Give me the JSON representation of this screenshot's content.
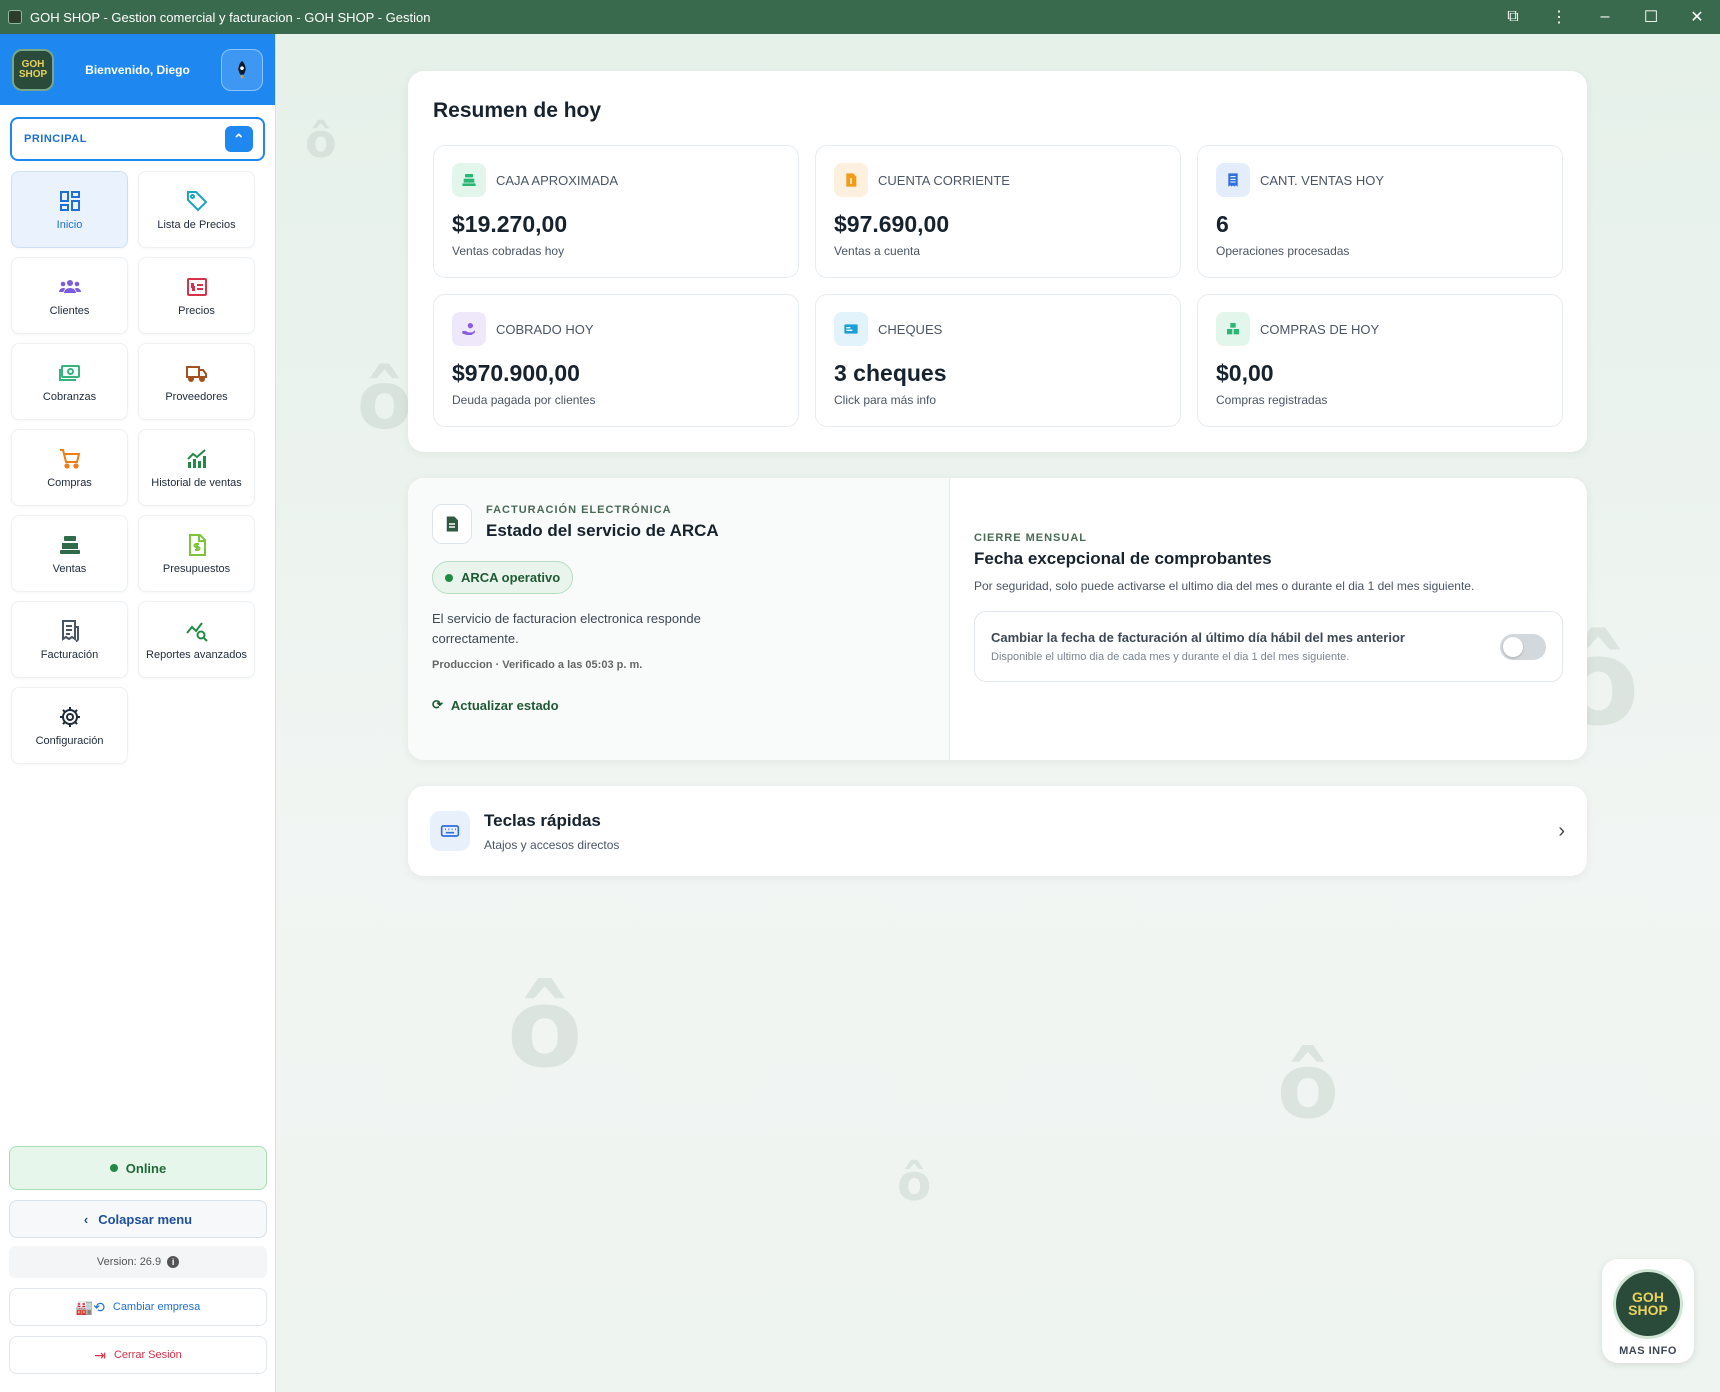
{
  "window": {
    "title": "GOH SHOP - Gestion comercial y facturacion - GOH SHOP - Gestion"
  },
  "sidebar": {
    "logo_text": "GOH SHOP",
    "welcome": "Bienvenido, Diego",
    "section_label": "PRINCIPAL",
    "items": [
      {
        "label": "Inicio",
        "icon": "dashboard-icon",
        "color": "#1e6fd6"
      },
      {
        "label": "Lista de Precios",
        "icon": "tag-icon",
        "color": "#1aa3c4"
      },
      {
        "label": "Clientes",
        "icon": "users-icon",
        "color": "#7b5ce0"
      },
      {
        "label": "Precios",
        "icon": "price-tag-icon",
        "color": "#d6324a"
      },
      {
        "label": "Cobranzas",
        "icon": "money-icon",
        "color": "#36b37e"
      },
      {
        "label": "Proveedores",
        "icon": "truck-icon",
        "color": "#a4511f"
      },
      {
        "label": "Compras",
        "icon": "cart-icon",
        "color": "#f07c16"
      },
      {
        "label": "Historial de ventas",
        "icon": "chart-line-icon",
        "color": "#238a45"
      },
      {
        "label": "Ventas",
        "icon": "cash-register-icon",
        "color": "#2f6a4a"
      },
      {
        "label": "Presupuestos",
        "icon": "file-dollar-icon",
        "color": "#7cc43a"
      },
      {
        "label": "Facturación",
        "icon": "receipt-icon",
        "color": "#4a5565"
      },
      {
        "label": "Reportes avanzados",
        "icon": "search-chart-icon",
        "color": "#238a45"
      },
      {
        "label": "Configuración",
        "icon": "gear-icon",
        "color": "#1e2a3a"
      }
    ],
    "status": "Online",
    "collapse_label": "Colapsar menu",
    "version": "Version: 26.9",
    "switch_company": "Cambiar empresa",
    "logout": "Cerrar Sesión"
  },
  "summary": {
    "title": "Resumen de hoy",
    "stats": [
      {
        "label": "CAJA APROXIMADA",
        "value": "$19.270,00",
        "sub": "Ventas cobradas hoy",
        "icon": "cash-register-icon",
        "color": "#2bb673",
        "bg": "#e3f6ec"
      },
      {
        "label": "CUENTA CORRIENTE",
        "value": "$97.690,00",
        "sub": "Ventas a cuenta",
        "icon": "file-dollar-icon",
        "color": "#f29b16",
        "bg": "#fdf0de"
      },
      {
        "label": "CANT. VENTAS HOY",
        "value": "6",
        "sub": "Operaciones procesadas",
        "icon": "receipt-icon",
        "color": "#2f6fe0",
        "bg": "#e4edfb"
      },
      {
        "label": "COBRADO HOY",
        "value": "$970.900,00",
        "sub": "Deuda pagada por clientes",
        "icon": "hand-money-icon",
        "color": "#8a5ce0",
        "bg": "#efe8fb"
      },
      {
        "label": "CHEQUES",
        "value": "3 cheques",
        "sub": "Click para más info",
        "icon": "check-icon",
        "color": "#1ea0d6",
        "bg": "#e2f3fb"
      },
      {
        "label": "COMPRAS DE HOY",
        "value": "$0,00",
        "sub": "Compras registradas",
        "icon": "boxes-icon",
        "color": "#2bb673",
        "bg": "#e3f6ec"
      }
    ]
  },
  "arca": {
    "eyebrow": "FACTURACIÓN ELECTRÓNICA",
    "title": "Estado del servicio de ARCA",
    "status": "ARCA operativo",
    "description": "El servicio de facturacion electronica responde correctamente.",
    "meta": "Produccion · Verificado a las 05:03 p. m.",
    "refresh": "Actualizar estado"
  },
  "monthly": {
    "eyebrow": "CIERRE MENSUAL",
    "title": "Fecha excepcional de comprobantes",
    "description": "Por seguridad, solo puede activarse el ultimo dia del mes o durante el dia 1 del mes siguiente.",
    "toggle_title": "Cambiar la fecha de facturación al último día hábil del mes anterior",
    "toggle_sub": "Disponible el ultimo dia de cada mes y durante el dia 1 del mes siguiente.",
    "toggle_on": false
  },
  "shortcuts": {
    "title": "Teclas rápidas",
    "subtitle": "Atajos y accesos directos"
  },
  "more_info": {
    "logo_text": "GOH SHOP",
    "label": "MAS INFO"
  }
}
